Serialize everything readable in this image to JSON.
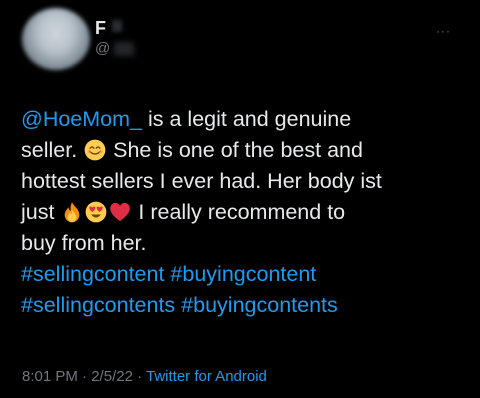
{
  "author": {
    "display_name": "F",
    "handle": "@"
  },
  "more_label": "···",
  "tweet": {
    "mention": "@HoeMom_",
    "line1_rest": " is a legit and genuine",
    "line2_a": "seller. ",
    "line2_b": " She is one of the best and",
    "line3": "hottest sellers I ever had. Her body ist",
    "line4_a": "just ",
    "line4_b": " I really recommend to",
    "line5": "buy from her.",
    "hashtags_line1_a": "#sellingcontent",
    "hashtags_line1_b": "#buyingcontent",
    "hashtags_line2_a": "#sellingcontents",
    "hashtags_line2_b": "#buyingcontents"
  },
  "meta": {
    "time": "8:01 PM",
    "sep1": " · ",
    "date": "2/5/22",
    "sep2": " · ",
    "source": "Twitter for Android"
  },
  "colors": {
    "background": "#000000",
    "text": "#e7e9ea",
    "secondary": "#71767b",
    "link": "#1d9bf0"
  },
  "icons": [
    "smiling-face-emoji",
    "fire-emoji",
    "heart-eyes-emoji",
    "red-heart-emoji",
    "more-options-icon"
  ]
}
